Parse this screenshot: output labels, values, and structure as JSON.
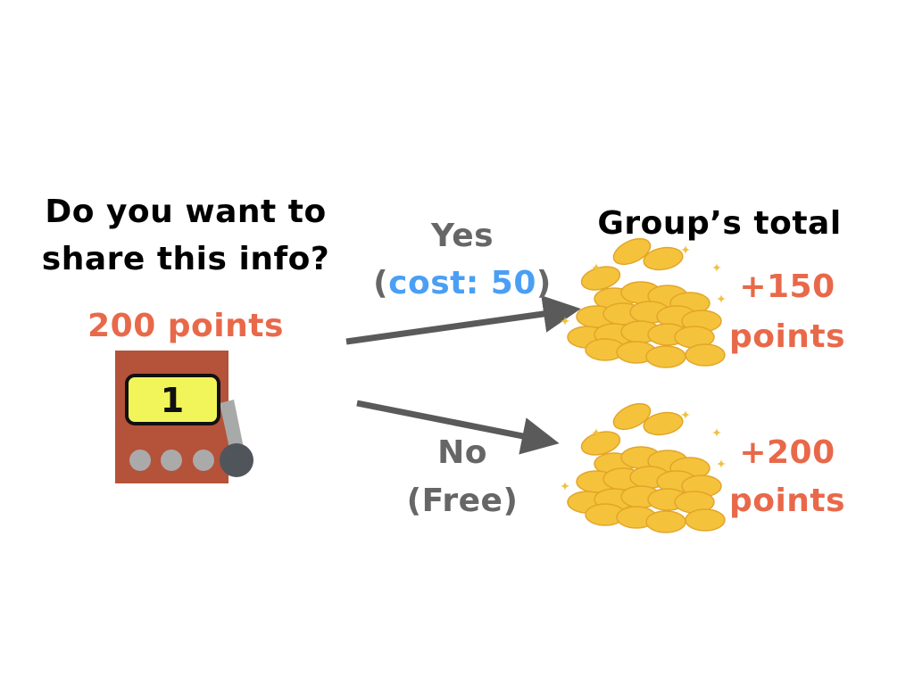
{
  "question": {
    "line1": "Do you want to",
    "line2": "share this info?"
  },
  "endowment": "200 points",
  "slot_machine": {
    "display": "1"
  },
  "yes_option": {
    "label": "Yes",
    "paren_open": "(",
    "cost": "cost: 50",
    "paren_close": ")"
  },
  "no_option": {
    "label": "No",
    "cost": "(Free)"
  },
  "group_total": {
    "title": "Group’s total",
    "yes_result": {
      "amount": "+150",
      "unit": "points"
    },
    "no_result": {
      "amount": "+200",
      "unit": "points"
    }
  },
  "colors": {
    "orange": "#E8694A",
    "blue": "#4A9FF5",
    "gray": "#666666",
    "machine": "#B5523A",
    "screen": "#F2F55A",
    "coin": "#F5C33B"
  }
}
